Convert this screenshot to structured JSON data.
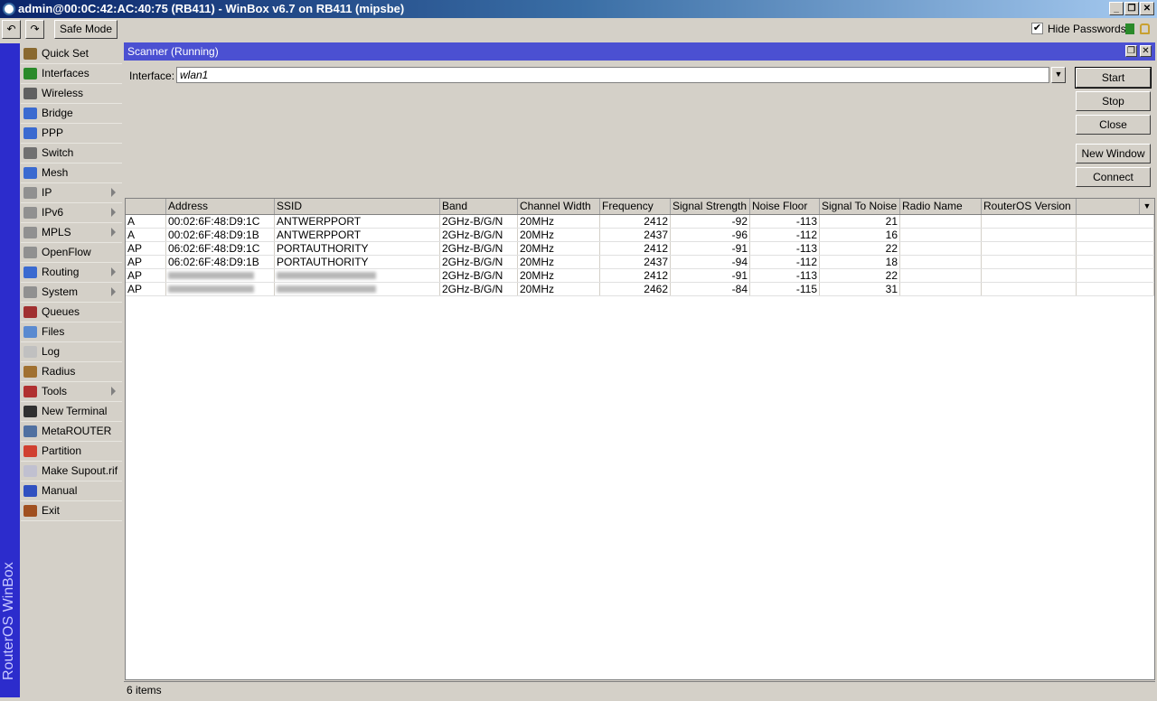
{
  "window": {
    "title": "admin@00:0C:42:AC:40:75 (RB411) - WinBox v6.7 on RB411 (mipsbe)",
    "minimize": "_",
    "restore": "❐",
    "close": "✕"
  },
  "toolbar": {
    "undo": "↶",
    "redo": "↷",
    "safe_mode": "Safe Mode",
    "hide_passwords": "Hide Passwords",
    "hide_passwords_checked": true
  },
  "sidebar": {
    "brand": "RouterOS WinBox",
    "items": [
      {
        "label": "Quick Set",
        "color": "#8a6a30",
        "sub": false
      },
      {
        "label": "Interfaces",
        "color": "#2a8a2a",
        "sub": false
      },
      {
        "label": "Wireless",
        "color": "#606060",
        "sub": false
      },
      {
        "label": "Bridge",
        "color": "#3a6ad0",
        "sub": false
      },
      {
        "label": "PPP",
        "color": "#3a6ad0",
        "sub": false
      },
      {
        "label": "Switch",
        "color": "#707070",
        "sub": false
      },
      {
        "label": "Mesh",
        "color": "#3a6ad0",
        "sub": false
      },
      {
        "label": "IP",
        "color": "#909090",
        "sub": true
      },
      {
        "label": "IPv6",
        "color": "#909090",
        "sub": true
      },
      {
        "label": "MPLS",
        "color": "#909090",
        "sub": true
      },
      {
        "label": "OpenFlow",
        "color": "#909090",
        "sub": false
      },
      {
        "label": "Routing",
        "color": "#3a6ad0",
        "sub": true
      },
      {
        "label": "System",
        "color": "#909090",
        "sub": true
      },
      {
        "label": "Queues",
        "color": "#a03030",
        "sub": false
      },
      {
        "label": "Files",
        "color": "#5a8ad0",
        "sub": false
      },
      {
        "label": "Log",
        "color": "#c0c0c0",
        "sub": false
      },
      {
        "label": "Radius",
        "color": "#a07030",
        "sub": false
      },
      {
        "label": "Tools",
        "color": "#b03030",
        "sub": true
      },
      {
        "label": "New Terminal",
        "color": "#303030",
        "sub": false
      },
      {
        "label": "MetaROUTER",
        "color": "#5070a0",
        "sub": false
      },
      {
        "label": "Partition",
        "color": "#d04030",
        "sub": false
      },
      {
        "label": "Make Supout.rif",
        "color": "#c0c0d0",
        "sub": false
      },
      {
        "label": "Manual",
        "color": "#3050c0",
        "sub": false
      },
      {
        "label": "Exit",
        "color": "#a05020",
        "sub": false
      }
    ]
  },
  "scanner": {
    "title": "Scanner (Running)",
    "interface_label": "Interface:",
    "interface_value": "wlan1",
    "buttons": {
      "start": "Start",
      "stop": "Stop",
      "close": "Close",
      "new_window": "New Window",
      "connect": "Connect"
    },
    "columns": [
      "",
      "Address",
      "SSID",
      "Band",
      "Channel Width",
      "Frequency",
      "Signal Strength",
      "Noise Floor",
      "Signal To Noise",
      "Radio Name",
      "RouterOS Version"
    ],
    "rows": [
      [
        "A",
        "00:02:6F:48:D9:1C",
        "ANTWERPPORT",
        "2GHz-B/G/N",
        "20MHz",
        "2412",
        "-92",
        "-113",
        "21",
        "",
        ""
      ],
      [
        "A",
        "00:02:6F:48:D9:1B",
        "ANTWERPPORT",
        "2GHz-B/G/N",
        "20MHz",
        "2437",
        "-96",
        "-112",
        "16",
        "",
        ""
      ],
      [
        "AP",
        "06:02:6F:48:D9:1C",
        "PORTAUTHORITY",
        "2GHz-B/G/N",
        "20MHz",
        "2412",
        "-91",
        "-113",
        "22",
        "",
        ""
      ],
      [
        "AP",
        "06:02:6F:48:D9:1B",
        "PORTAUTHORITY",
        "2GHz-B/G/N",
        "20MHz",
        "2437",
        "-94",
        "-112",
        "18",
        "",
        ""
      ],
      [
        "AP",
        null,
        null,
        "2GHz-B/G/N",
        "20MHz",
        "2412",
        "-91",
        "-113",
        "22",
        "",
        ""
      ],
      [
        "AP",
        null,
        null,
        "2GHz-B/G/N",
        "20MHz",
        "2462",
        "-84",
        "-115",
        "31",
        "",
        ""
      ]
    ],
    "status": "6 items"
  }
}
